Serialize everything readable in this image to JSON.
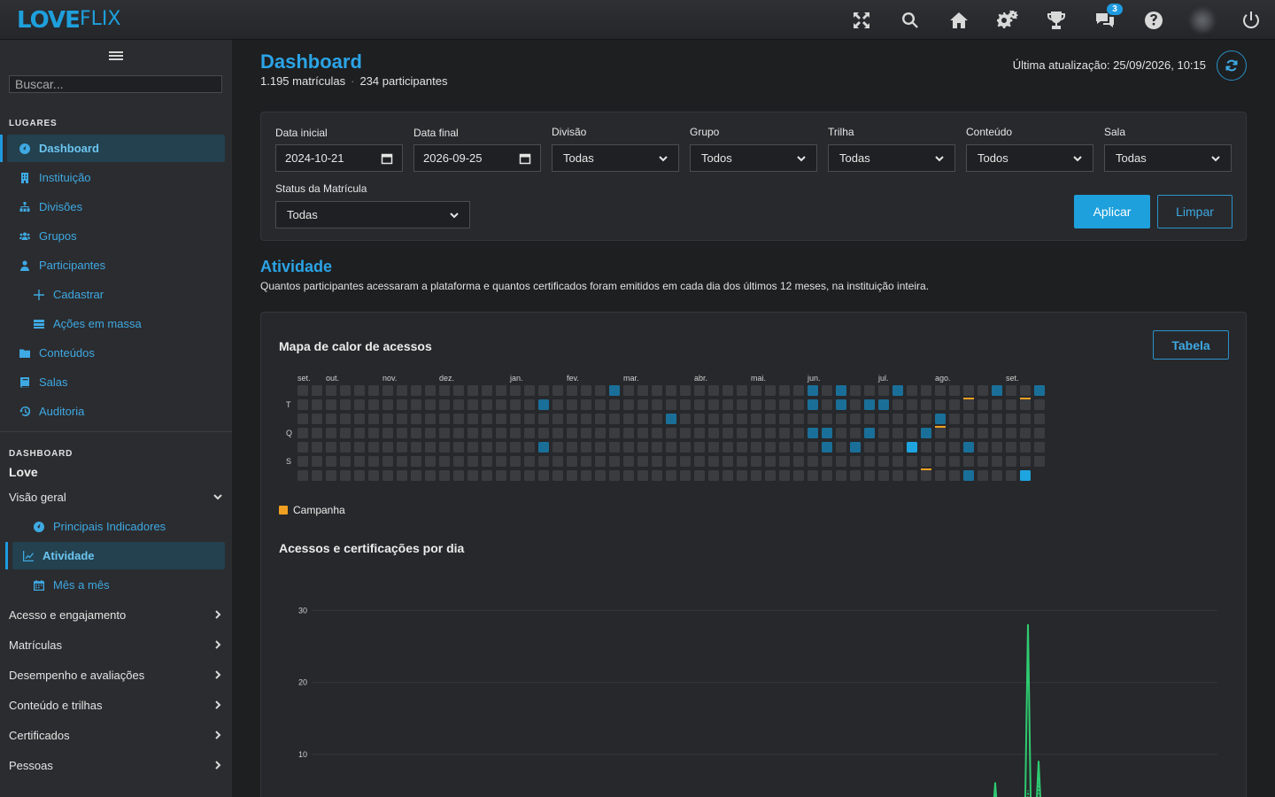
{
  "brand": {
    "logo_bold": "LOVE",
    "logo_light": "FLIX"
  },
  "topbar": {
    "icons": [
      "fullscreen-icon",
      "search-icon",
      "home-icon",
      "settings-icon",
      "trophy-icon",
      "chat-icon",
      "help-icon",
      "avatar",
      "power-icon"
    ],
    "chat_badge": "3"
  },
  "sidebar": {
    "search_placeholder": "Buscar...",
    "section_places": "LUGARES",
    "places": [
      {
        "label": "Dashboard",
        "icon": "dashboard-icon",
        "active": true
      },
      {
        "label": "Instituição",
        "icon": "building-icon"
      },
      {
        "label": "Divisões",
        "icon": "sitemap-icon"
      },
      {
        "label": "Grupos",
        "icon": "users-icon"
      },
      {
        "label": "Participantes",
        "icon": "user-icon"
      },
      {
        "label": "Cadastrar",
        "icon": "plus-icon",
        "sub": true
      },
      {
        "label": "Ações em massa",
        "icon": "list-icon",
        "sub": true
      },
      {
        "label": "Conteúdos",
        "icon": "folder-icon"
      },
      {
        "label": "Salas",
        "icon": "book-icon"
      },
      {
        "label": "Auditoria",
        "icon": "history-icon"
      }
    ],
    "section_dashboard": "DASHBOARD",
    "dashboard_name": "Love",
    "overview": {
      "label": "Visão geral",
      "items": [
        {
          "label": "Principais Indicadores",
          "icon": "gauge-icon"
        },
        {
          "label": "Atividade",
          "icon": "line-chart-icon",
          "active": true
        },
        {
          "label": "Mês a mês",
          "icon": "calendar-icon"
        }
      ]
    },
    "groups": [
      "Acesso e engajamento",
      "Matrículas",
      "Desempenho e avaliações",
      "Conteúdo e trilhas",
      "Certificados",
      "Pessoas"
    ]
  },
  "header": {
    "title": "Dashboard",
    "enrollments": "1.195 matrículas",
    "separator": "·",
    "participants": "234 participantes",
    "last_update": "Última atualização: 25/09/2026, 10:15"
  },
  "filters": {
    "start_label": "Data inicial",
    "start_value": "2024-10-21",
    "end_label": "Data final",
    "end_value": "2026-09-25",
    "division_label": "Divisão",
    "division_value": "Todas",
    "group_label": "Grupo",
    "group_value": "Todos",
    "track_label": "Trilha",
    "track_value": "Todas",
    "content_label": "Conteúdo",
    "content_value": "Todos",
    "room_label": "Sala",
    "room_value": "Todas",
    "status_label": "Status da Matrícula",
    "status_value": "Todas",
    "apply": "Aplicar",
    "clear": "Limpar"
  },
  "activity": {
    "title": "Atividade",
    "description": "Quantos participantes acessaram a plataforma e quantos certificados foram emitidos em cada dia dos últimos 12 meses, na instituição inteira.",
    "heatmap_title": "Mapa de calor de acessos",
    "table_button": "Tabela",
    "heatmap": {
      "months": [
        {
          "label": "set.",
          "week": 0
        },
        {
          "label": "out.",
          "week": 2
        },
        {
          "label": "nov.",
          "week": 6
        },
        {
          "label": "dez.",
          "week": 10
        },
        {
          "label": "jan.",
          "week": 15
        },
        {
          "label": "fev.",
          "week": 19
        },
        {
          "label": "mar.",
          "week": 23
        },
        {
          "label": "abr.",
          "week": 28
        },
        {
          "label": "mai.",
          "week": 32
        },
        {
          "label": "jun.",
          "week": 36
        },
        {
          "label": "jul.",
          "week": 41
        },
        {
          "label": "ago.",
          "week": 45
        },
        {
          "label": "set.",
          "week": 50
        }
      ],
      "day_labels": [
        {
          "label": "T",
          "row": 1
        },
        {
          "label": "Q",
          "row": 3
        },
        {
          "label": "S",
          "row": 5
        }
      ],
      "weeks": 53,
      "active_cells": [
        [
          22,
          0,
          2
        ],
        [
          17,
          1,
          2
        ],
        [
          26,
          2,
          2
        ],
        [
          17,
          4,
          2
        ],
        [
          36,
          0,
          2
        ],
        [
          38,
          0,
          2
        ],
        [
          42,
          0,
          2
        ],
        [
          49,
          0,
          2
        ],
        [
          52,
          0,
          2
        ],
        [
          36,
          1,
          2
        ],
        [
          38,
          1,
          2
        ],
        [
          40,
          1,
          2
        ],
        [
          41,
          1,
          2
        ],
        [
          45,
          2,
          2
        ],
        [
          36,
          3,
          2
        ],
        [
          37,
          3,
          2
        ],
        [
          40,
          3,
          2
        ],
        [
          44,
          3,
          2
        ],
        [
          37,
          4,
          2
        ],
        [
          39,
          4,
          2
        ],
        [
          43,
          4,
          3
        ],
        [
          47,
          4,
          2
        ],
        [
          47,
          6,
          2
        ],
        [
          51,
          6,
          3
        ]
      ],
      "campaign_cells": [
        [
          47,
          0
        ],
        [
          51,
          0
        ],
        [
          45,
          2
        ],
        [
          44,
          5
        ]
      ],
      "empty_after": [
        52,
        5
      ],
      "legend": "Campanha"
    },
    "line_title": "Acessos e certificações por dia",
    "chart_data": {
      "type": "line",
      "title": "Acessos e certificações por dia",
      "yticks": [
        10,
        20,
        30
      ],
      "ylim": [
        0,
        32
      ],
      "series": [
        {
          "values": [
            [
              1123,
              6
            ],
            [
              1155,
              2
            ],
            [
              1160,
              28
            ],
            [
              1166,
              3
            ],
            [
              1172,
              9
            ],
            [
              1343,
              2
            ]
          ]
        },
        {
          "values": [
            [
              1160,
              5
            ],
            [
              1172,
              6
            ]
          ]
        }
      ]
    }
  }
}
